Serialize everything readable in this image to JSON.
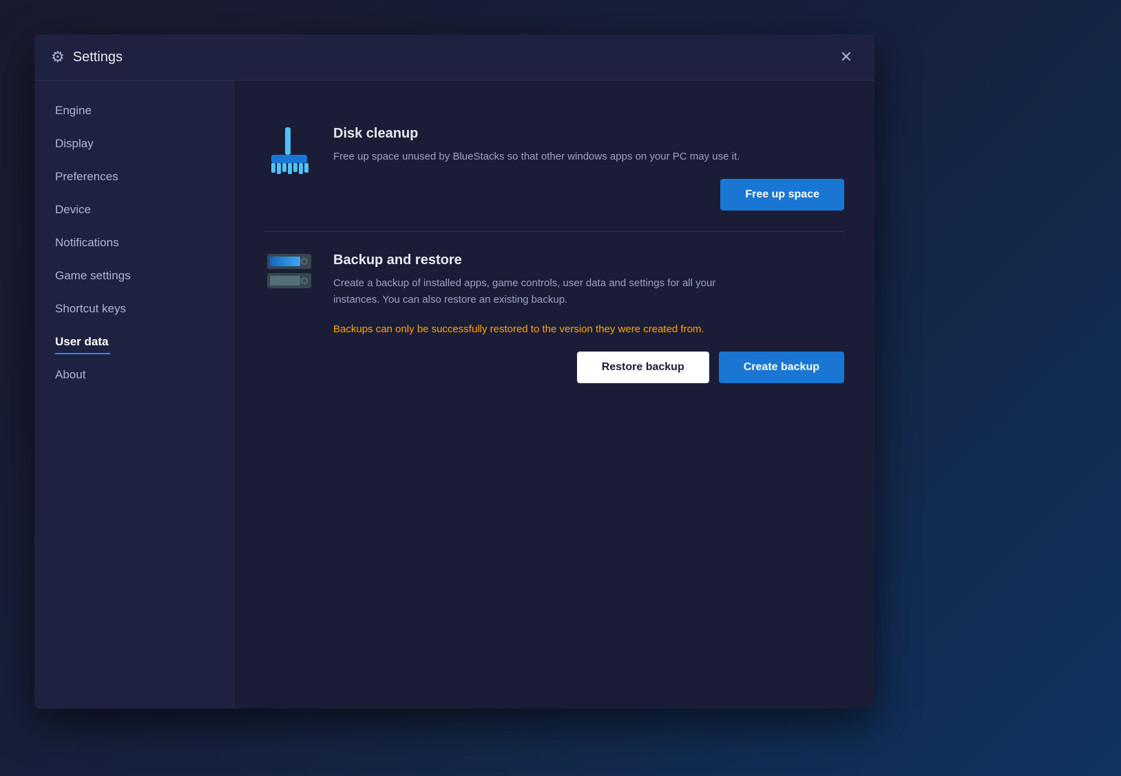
{
  "dialog": {
    "title": "Settings",
    "title_icon": "⚙",
    "close_icon": "✕"
  },
  "sidebar": {
    "items": [
      {
        "id": "engine",
        "label": "Engine",
        "active": false
      },
      {
        "id": "display",
        "label": "Display",
        "active": false
      },
      {
        "id": "preferences",
        "label": "Preferences",
        "active": false
      },
      {
        "id": "device",
        "label": "Device",
        "active": false
      },
      {
        "id": "notifications",
        "label": "Notifications",
        "active": false
      },
      {
        "id": "game-settings",
        "label": "Game settings",
        "active": false
      },
      {
        "id": "shortcut-keys",
        "label": "Shortcut keys",
        "active": false
      },
      {
        "id": "user-data",
        "label": "User data",
        "active": true
      },
      {
        "id": "about",
        "label": "About",
        "active": false
      }
    ]
  },
  "main": {
    "disk_cleanup": {
      "title": "Disk cleanup",
      "description": "Free up space unused by BlueStacks so that other windows apps on your PC may use it.",
      "button_label": "Free up space"
    },
    "backup_restore": {
      "title": "Backup and restore",
      "description": "Create a backup of installed apps, game controls, user data and settings for all your instances. You can also restore an existing backup.",
      "warning": "Backups can only be successfully restored to the version they were created from.",
      "restore_label": "Restore backup",
      "create_label": "Create backup"
    }
  },
  "icons": {
    "settings": "⚙",
    "close": "✕",
    "disk_cleanup_unicode": "🧹",
    "backup_unicode": "💾"
  }
}
